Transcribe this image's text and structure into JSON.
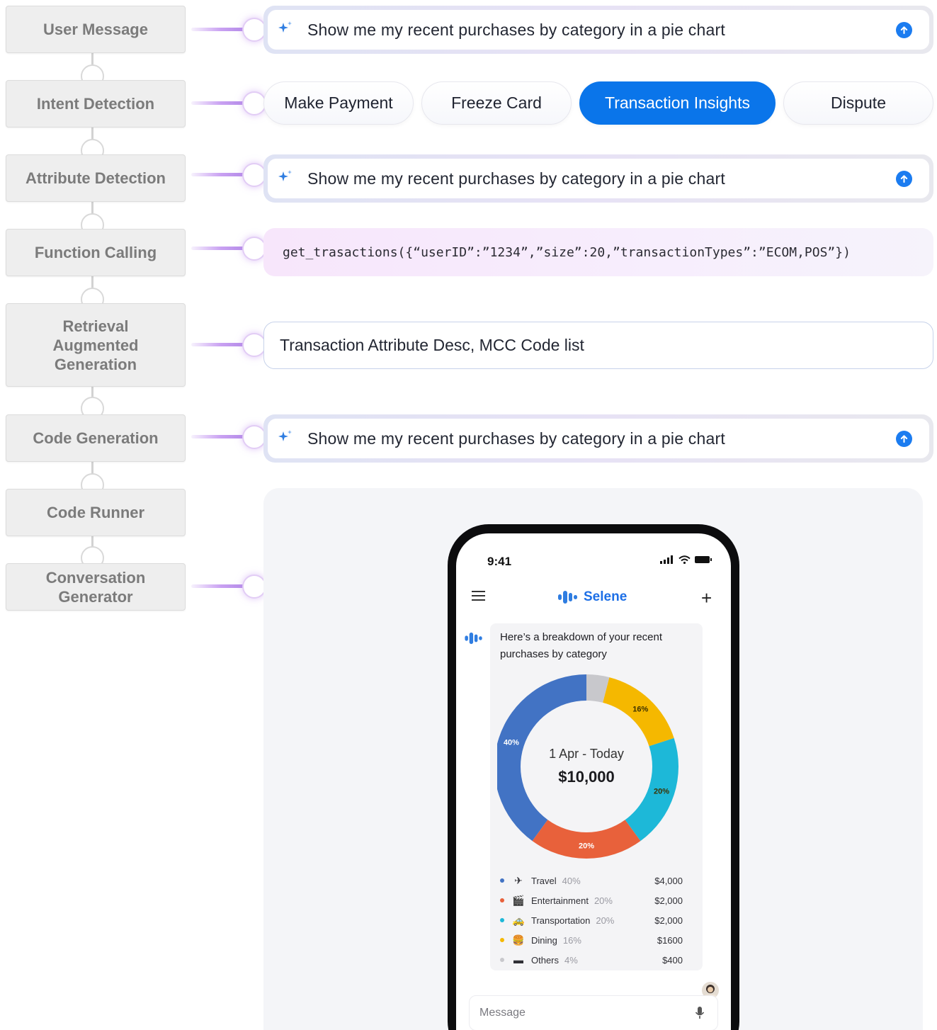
{
  "pipeline": {
    "steps": [
      {
        "lines": [
          "User Message"
        ]
      },
      {
        "lines": [
          "Intent Detection"
        ]
      },
      {
        "lines": [
          "Attribute Detection"
        ]
      },
      {
        "lines": [
          "Function Calling"
        ]
      },
      {
        "lines": [
          "Retrieval",
          "Augmented",
          "Generation"
        ]
      },
      {
        "lines": [
          "Code Generation"
        ]
      },
      {
        "lines": [
          "Code Runner"
        ]
      },
      {
        "lines": [
          "Conversation",
          "Generator"
        ]
      }
    ]
  },
  "outputs": {
    "user_prompt": "Show me my recent purchases by category in a pie chart",
    "intents": [
      "Make Payment",
      "Freeze Card",
      "Transaction Insights",
      "Dispute"
    ],
    "active_intent": "Transaction Insights",
    "attribute_prompt": "Show me my recent purchases by category in a pie chart",
    "function_call": "get_trasactions({“userID”:”1234”,”size”:20,”transactionTypes”:”ECOM,POS”})",
    "rag_sources": "Transaction Attribute Desc, MCC Code list",
    "codegen_prompt": "Show me my recent purchases by category in a pie chart"
  },
  "phone": {
    "time": "9:41",
    "app_name": "Selene",
    "bot_message": "Here’s a breakdown of your recent purchases by category",
    "composer_placeholder": "Message"
  },
  "chart_data": {
    "type": "pie",
    "center_label": "1 Apr - Today",
    "total": "$10,000",
    "slices": [
      {
        "name": "Travel",
        "percent": 40,
        "label": "40%",
        "amount": "$4,000",
        "color": "#4273c4",
        "icon": "airplane-icon"
      },
      {
        "name": "Entertainment",
        "percent": 20,
        "label": "20%",
        "amount": "$2,000",
        "color": "#e8613b",
        "icon": "clapperboard-icon"
      },
      {
        "name": "Transportation",
        "percent": 20,
        "label": "20%",
        "amount": "$2,000",
        "color": "#1db8d8",
        "icon": "car-icon"
      },
      {
        "name": "Dining",
        "percent": 16,
        "label": "16%",
        "amount": "$1600",
        "color": "#f5b800",
        "icon": "burger-icon"
      },
      {
        "name": "Others",
        "percent": 4,
        "label": "4%",
        "amount": "$400",
        "color": "#c8c8cc",
        "icon": "card-icon"
      }
    ]
  },
  "colors": {
    "accent": "#0a75ea",
    "step_text": "#7b7b7b",
    "connector": "#c9a1f2"
  }
}
